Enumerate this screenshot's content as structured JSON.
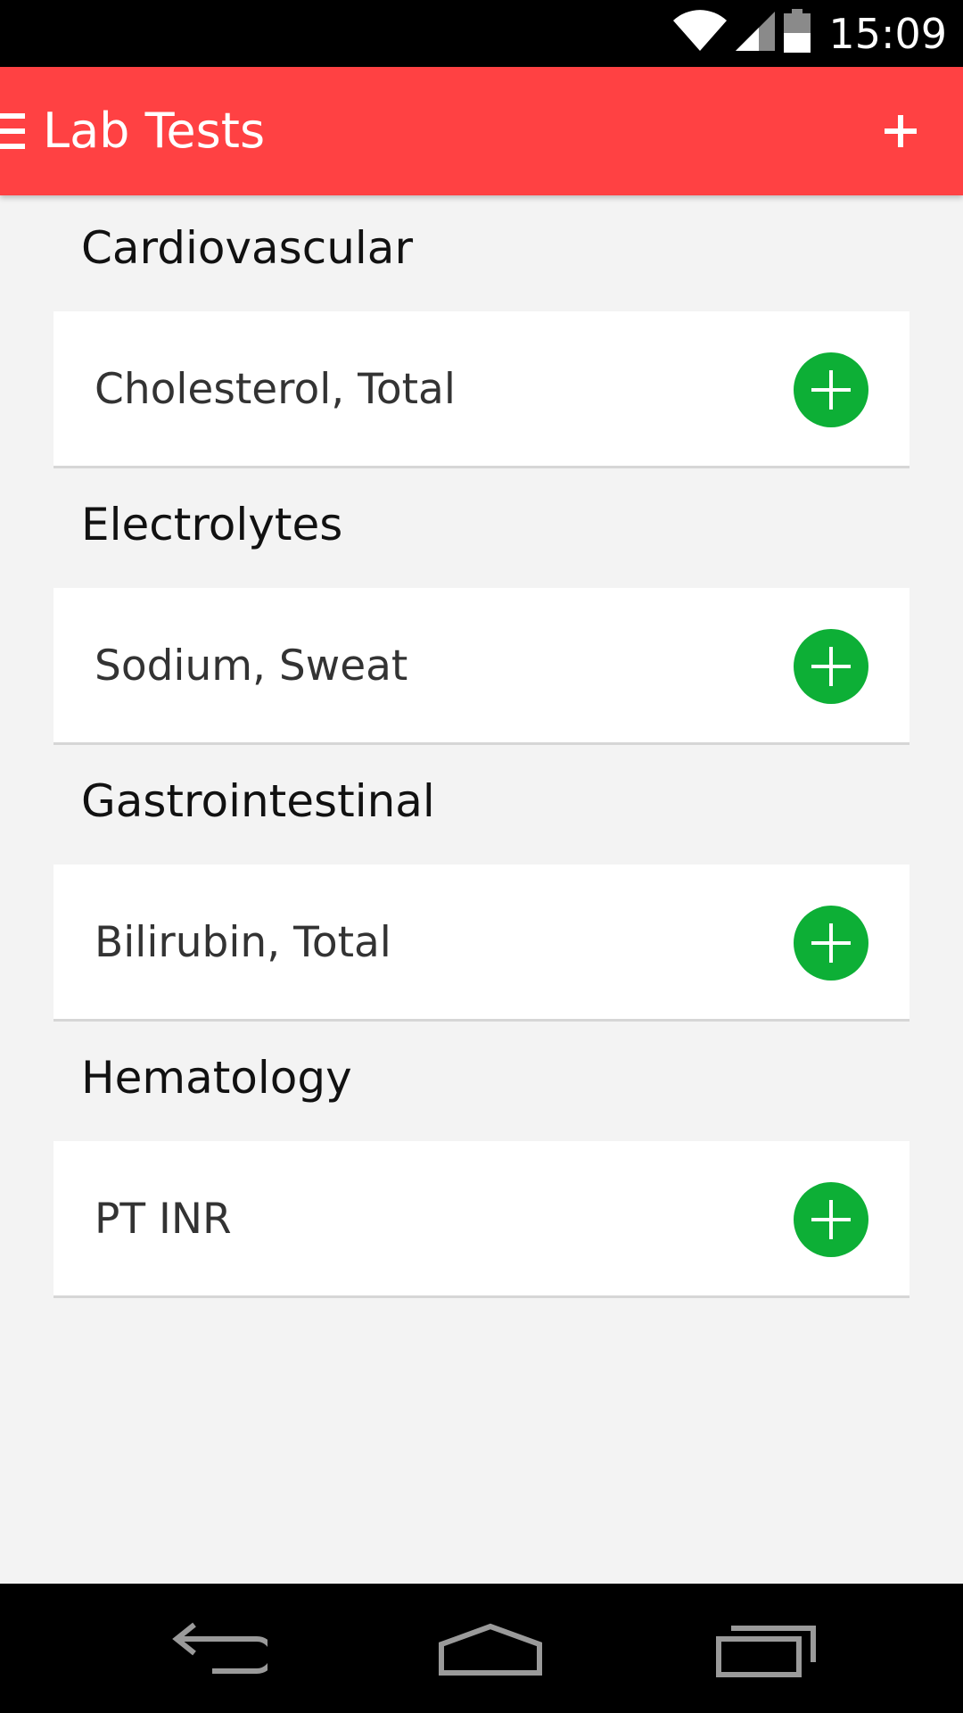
{
  "status_bar": {
    "time": "15:09",
    "icons": [
      "wifi-icon",
      "signal-icon",
      "battery-icon"
    ]
  },
  "app_bar": {
    "title": "Lab Tests",
    "menu_icon": "menu-icon",
    "add_icon": "add-icon",
    "background": "#ff4143"
  },
  "sections": [
    {
      "header": "Cardiovascular",
      "items": [
        {
          "label": "Cholesterol, Total"
        }
      ]
    },
    {
      "header": "Electrolytes",
      "items": [
        {
          "label": "Sodium, Sweat"
        }
      ]
    },
    {
      "header": "Gastrointestinal",
      "items": [
        {
          "label": "Bilirubin, Total"
        }
      ]
    },
    {
      "header": "Hematology",
      "items": [
        {
          "label": "PT INR"
        }
      ]
    }
  ],
  "accent_add_color": "#0daf36",
  "nav_bar": {
    "buttons": [
      "back-icon",
      "home-icon",
      "recents-icon"
    ]
  }
}
